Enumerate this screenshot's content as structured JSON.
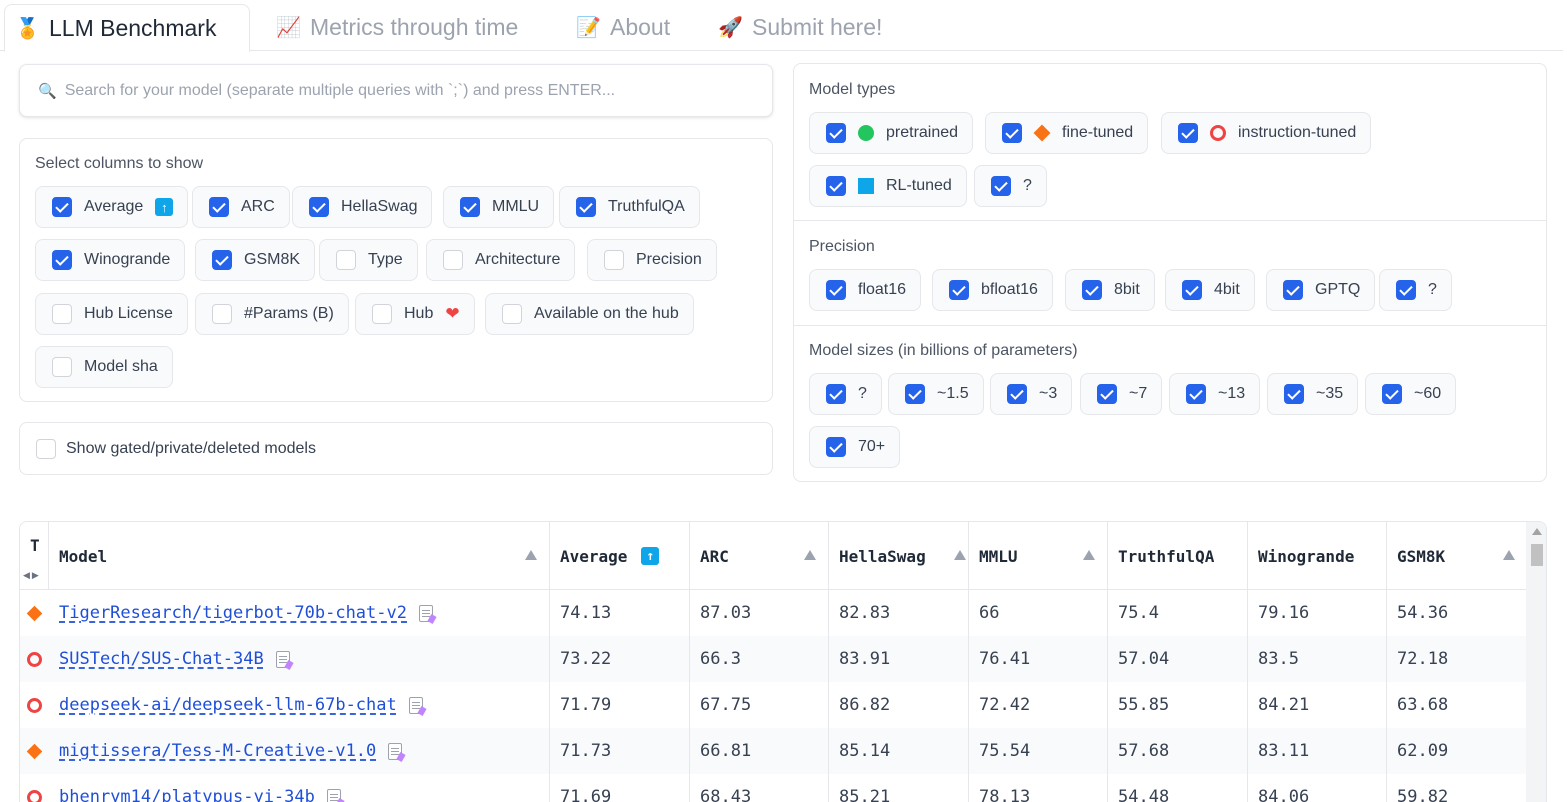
{
  "tabs": [
    {
      "icon": "🏅",
      "label": "LLM Benchmark",
      "active": true
    },
    {
      "icon": "📈",
      "label": "Metrics through time",
      "active": false
    },
    {
      "icon": "📝",
      "label": "About",
      "active": false
    },
    {
      "icon": "🚀",
      "label": "Submit here!",
      "active": false
    }
  ],
  "search": {
    "icon": "🔍",
    "placeholder": "Search for your model (separate multiple queries with `;`) and press ENTER..."
  },
  "columns_panel": {
    "label": "Select columns to show",
    "items": [
      {
        "label": "Average",
        "checked": true,
        "badge": "up-arrow-icon"
      },
      {
        "label": "ARC",
        "checked": true
      },
      {
        "label": "HellaSwag",
        "checked": true
      },
      {
        "label": "MMLU",
        "checked": true
      },
      {
        "label": "TruthfulQA",
        "checked": true
      },
      {
        "label": "Winogrande",
        "checked": true
      },
      {
        "label": "GSM8K",
        "checked": true
      },
      {
        "label": "Type",
        "checked": false
      },
      {
        "label": "Architecture",
        "checked": false
      },
      {
        "label": "Precision",
        "checked": false
      },
      {
        "label": "Hub License",
        "checked": false
      },
      {
        "label": "#Params (B)",
        "checked": false
      },
      {
        "label": "Hub",
        "checked": false,
        "badge": "heart-icon"
      },
      {
        "label": "Available on the hub",
        "checked": false
      },
      {
        "label": "Model sha",
        "checked": false
      }
    ]
  },
  "gated": {
    "label": "Show gated/private/deleted models",
    "checked": false
  },
  "model_types": {
    "label": "Model types",
    "items": [
      {
        "label": "pretrained",
        "checked": true,
        "icon": "green-circle-icon",
        "color": "#22c55e"
      },
      {
        "label": "fine-tuned",
        "checked": true,
        "icon": "orange-diamond-icon",
        "color": "#f97316"
      },
      {
        "label": "instruction-tuned",
        "checked": true,
        "icon": "red-ring-icon",
        "color": "#ef4444"
      },
      {
        "label": "RL-tuned",
        "checked": true,
        "icon": "blue-square-icon",
        "color": "#0ea5e9"
      },
      {
        "label": "?",
        "checked": true
      }
    ]
  },
  "precision": {
    "label": "Precision",
    "items": [
      {
        "label": "float16",
        "checked": true
      },
      {
        "label": "bfloat16",
        "checked": true
      },
      {
        "label": "8bit",
        "checked": true
      },
      {
        "label": "4bit",
        "checked": true
      },
      {
        "label": "GPTQ",
        "checked": true
      },
      {
        "label": "?",
        "checked": true
      }
    ]
  },
  "model_sizes": {
    "label": "Model sizes (in billions of parameters)",
    "items": [
      {
        "label": "?",
        "checked": true
      },
      {
        "label": "~1.5",
        "checked": true
      },
      {
        "label": "~3",
        "checked": true
      },
      {
        "label": "~7",
        "checked": true
      },
      {
        "label": "~13",
        "checked": true
      },
      {
        "label": "~35",
        "checked": true
      },
      {
        "label": "~60",
        "checked": true
      },
      {
        "label": "70+",
        "checked": true
      }
    ]
  },
  "table": {
    "type_header": "T",
    "headers": [
      "Model",
      "Average",
      "ARC",
      "HellaSwag",
      "MMLU",
      "TruthfulQA",
      "Winogrande",
      "GSM8K"
    ],
    "rows": [
      {
        "type": "fine-tuned",
        "model": "TigerResearch/tigerbot-70b-chat-v2",
        "values": [
          "74.13",
          "87.03",
          "82.83",
          "66",
          "75.4",
          "79.16",
          "54.36"
        ]
      },
      {
        "type": "instruction-tuned",
        "model": "SUSTech/SUS-Chat-34B",
        "values": [
          "73.22",
          "66.3",
          "83.91",
          "76.41",
          "57.04",
          "83.5",
          "72.18"
        ]
      },
      {
        "type": "instruction-tuned",
        "model": "deepseek-ai/deepseek-llm-67b-chat",
        "values": [
          "71.79",
          "67.75",
          "86.82",
          "72.42",
          "55.85",
          "84.21",
          "63.68"
        ]
      },
      {
        "type": "fine-tuned",
        "model": "migtissera/Tess-M-Creative-v1.0",
        "values": [
          "71.73",
          "66.81",
          "85.14",
          "75.54",
          "57.68",
          "83.11",
          "62.09"
        ]
      },
      {
        "type": "instruction-tuned",
        "model": "bhenrym14/platypus-yi-34b",
        "values": [
          "71.69",
          "68.43",
          "85.21",
          "78.13",
          "54.48",
          "84.06",
          "59.82"
        ]
      }
    ]
  }
}
